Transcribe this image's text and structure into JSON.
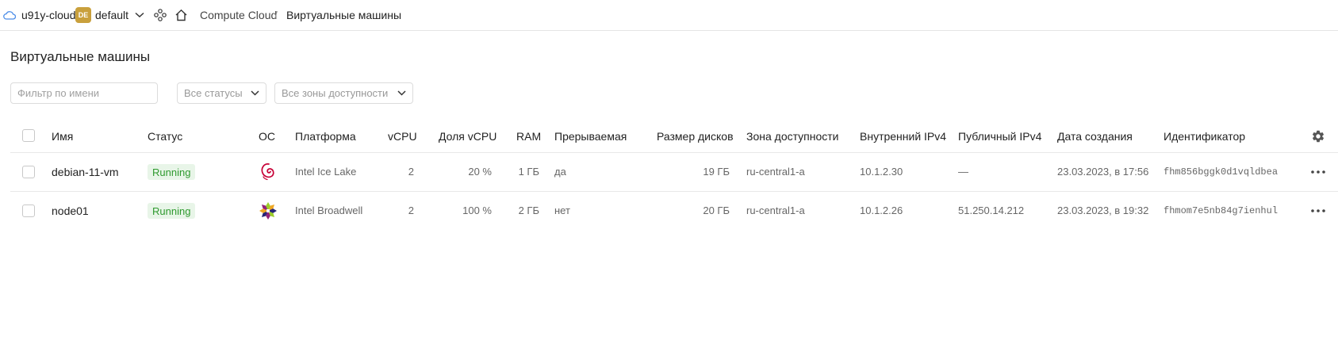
{
  "header": {
    "cloud_name": "u91y-cloud",
    "folder_badge": "DE",
    "folder_name": "default",
    "breadcrumb": {
      "service": "Compute Cloud",
      "separator": "/",
      "page": "Виртуальные машины"
    }
  },
  "page": {
    "title": "Виртуальные машины"
  },
  "filters": {
    "name_placeholder": "Фильтр по имени",
    "status_select": "Все статусы",
    "zone_select": "Все зоны доступности"
  },
  "table": {
    "columns": {
      "name": "Имя",
      "status": "Статус",
      "os": "ОС",
      "platform": "Платформа",
      "vcpu": "vCPU",
      "vcpu_share": "Доля vCPU",
      "ram": "RAM",
      "preemptible": "Прерываемая",
      "disk_size": "Размер дисков",
      "zone": "Зона доступности",
      "internal_ip": "Внутренний IPv4",
      "public_ip": "Публичный IPv4",
      "created": "Дата создания",
      "id": "Идентификатор"
    },
    "rows": [
      {
        "name": "debian-11-vm",
        "status": "Running",
        "os_icon": "debian-logo",
        "platform": "Intel Ice Lake",
        "vcpu": "2",
        "vcpu_share": "20 %",
        "ram": "1 ГБ",
        "preemptible": "да",
        "disk_size": "19 ГБ",
        "zone": "ru-central1-a",
        "internal_ip": "10.1.2.30",
        "public_ip": "—",
        "created": "23.03.2023, в 17:56",
        "id": "fhm856bggk0d1vqldbea"
      },
      {
        "name": "node01",
        "status": "Running",
        "os_icon": "centos-logo",
        "platform": "Intel Broadwell",
        "vcpu": "2",
        "vcpu_share": "100 %",
        "ram": "2 ГБ",
        "preemptible": "нет",
        "disk_size": "20 ГБ",
        "zone": "ru-central1-a",
        "internal_ip": "10.1.2.26",
        "public_ip": "51.250.14.212",
        "created": "23.03.2023, в 19:32",
        "id": "fhmom7e5nb84g7ienhul"
      }
    ]
  },
  "colors": {
    "status_running_text": "#2f9a2f",
    "status_running_bg": "#e8f5e8",
    "folder_badge_bg": "#c9a03c",
    "cloud_icon": "#4d8ee8"
  }
}
